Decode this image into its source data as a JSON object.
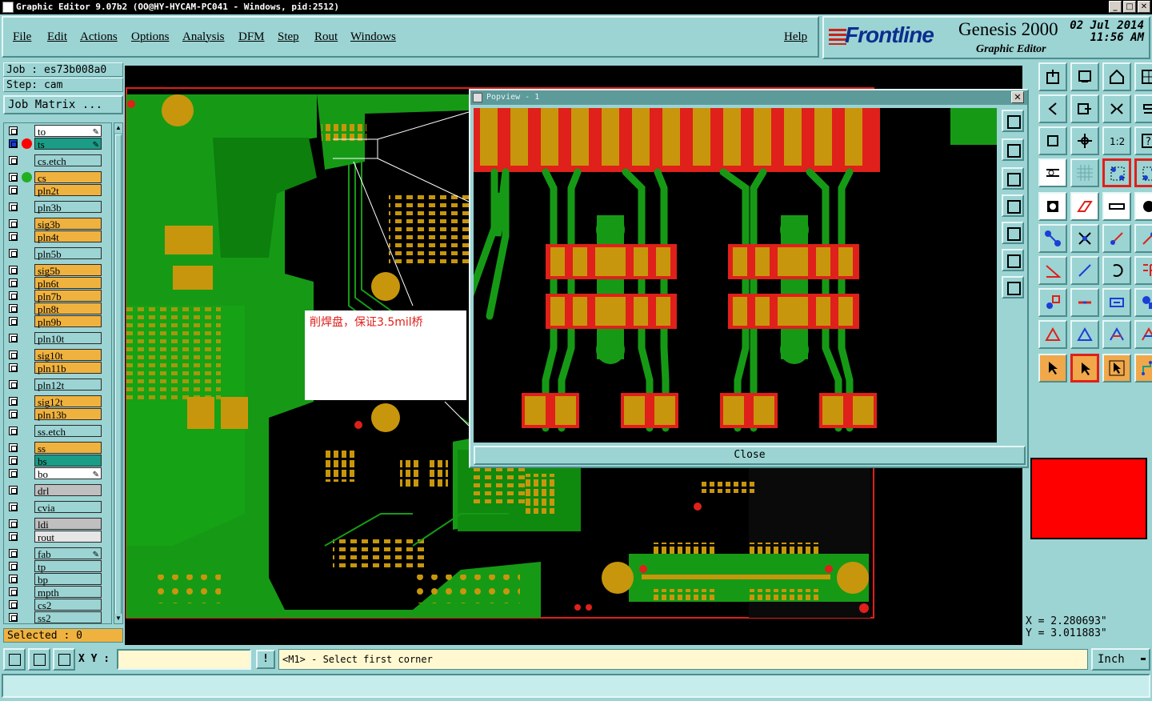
{
  "window": {
    "title": "Graphic Editor 9.07b2 (OO@HY-HYCAM-PC041 - Windows, pid:2512)",
    "minimize": "_",
    "maximize": "□",
    "close": "✕"
  },
  "menu": [
    "File",
    "Edit",
    "Actions",
    "Options",
    "Analysis",
    "DFM",
    "Step",
    "Rout",
    "Windows"
  ],
  "help": "Help",
  "brand": {
    "logo": "Frontline",
    "product": "Genesis 2000",
    "subtitle": "Graphic Editor",
    "date": "02 Jul 2014",
    "time": "11:56 AM"
  },
  "job": {
    "job_line": "Job : es73b008a0",
    "step_line": "Step: cam",
    "job_matrix": "Job Matrix ..."
  },
  "layers": [
    {
      "name": "to",
      "color": "#ffffff",
      "edit": true,
      "dot": ""
    },
    {
      "name": "ts",
      "color": "#1a9c86",
      "edit": true,
      "dot": "#ff0000",
      "active": true
    },
    {
      "name": "cs.etch",
      "color": "#9cd3d3",
      "dot": ""
    },
    {
      "name": "cs",
      "color": "#f0b23e",
      "dot": "#22b022"
    },
    {
      "name": "pln2t",
      "color": "#f0b23e",
      "dot": ""
    },
    {
      "name": "pln3b",
      "color": "#9cd3d3",
      "dot": ""
    },
    {
      "name": "sig3b",
      "color": "#f0b23e",
      "dot": ""
    },
    {
      "name": "pln4t",
      "color": "#f0b23e",
      "dot": ""
    },
    {
      "name": "pln5b",
      "color": "#9cd3d3",
      "dot": ""
    },
    {
      "name": "sig5b",
      "color": "#f0b23e",
      "dot": ""
    },
    {
      "name": "pln6t",
      "color": "#f0b23e",
      "dot": ""
    },
    {
      "name": "pln7b",
      "color": "#f0b23e",
      "dot": ""
    },
    {
      "name": "pln8t",
      "color": "#f0b23e",
      "dot": ""
    },
    {
      "name": "pln9b",
      "color": "#f0b23e",
      "dot": ""
    },
    {
      "name": "pln10t",
      "color": "#9cd3d3",
      "dot": ""
    },
    {
      "name": "sig10t",
      "color": "#f0b23e",
      "dot": ""
    },
    {
      "name": "pln11b",
      "color": "#f0b23e",
      "dot": ""
    },
    {
      "name": "pln12t",
      "color": "#9cd3d3",
      "dot": ""
    },
    {
      "name": "sig12t",
      "color": "#f0b23e",
      "dot": ""
    },
    {
      "name": "pln13b",
      "color": "#f0b23e",
      "dot": ""
    },
    {
      "name": "ss.etch",
      "color": "#9cd3d3",
      "dot": ""
    },
    {
      "name": "ss",
      "color": "#f0b23e",
      "dot": ""
    },
    {
      "name": "bs",
      "color": "#1a9c86",
      "dot": ""
    },
    {
      "name": "bo",
      "color": "#ffffff",
      "edit": true,
      "dot": ""
    },
    {
      "name": "drl",
      "color": "#bfbfbf",
      "dot": ""
    },
    {
      "name": "cvia",
      "color": "#9cd3d3",
      "dot": ""
    },
    {
      "name": "ldi",
      "color": "#bfbfbf",
      "dot": ""
    },
    {
      "name": "rout",
      "color": "#e6e6e6",
      "dot": ""
    },
    {
      "name": "fab",
      "color": "#9cd3d3",
      "edit": true,
      "dot": ""
    },
    {
      "name": "tp",
      "color": "#9cd3d3",
      "dot": ""
    },
    {
      "name": "bp",
      "color": "#9cd3d3",
      "dot": ""
    },
    {
      "name": "mpth",
      "color": "#9cd3d3",
      "dot": ""
    },
    {
      "name": "cs2",
      "color": "#9cd3d3",
      "dot": ""
    },
    {
      "name": "ss2",
      "color": "#9cd3d3",
      "dot": ""
    }
  ],
  "selected": "Selected : 0",
  "annotation": "削焊盘，保证3.5mil桥",
  "popview": {
    "title": "Popview - 1",
    "close_label": "Close"
  },
  "coords": {
    "x": "X  = 2.280693\"",
    "y": "Y  = 3.011883\""
  },
  "xy_label": "X Y :",
  "xy_value": "",
  "excl": "!",
  "status": "<M1> - Select first corner",
  "units": "Inch",
  "units_arrow": "▬"
}
